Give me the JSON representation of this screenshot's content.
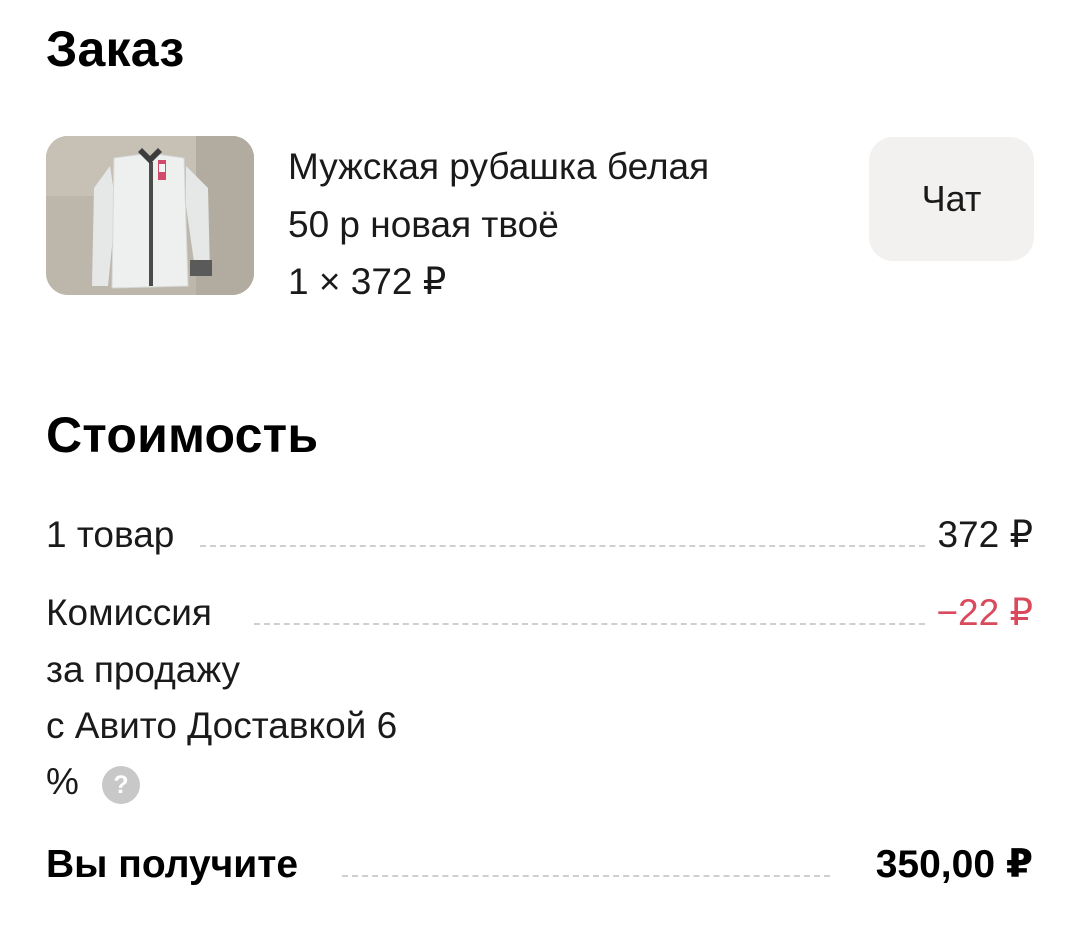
{
  "order": {
    "title": "Заказ",
    "product": {
      "name_line1": "Мужская рубашка белая",
      "name_line2": "50 р новая твоё",
      "qty_price": "1 × 372 ₽"
    },
    "chat_label": "Чат"
  },
  "cost": {
    "title": "Стоимость",
    "items_label": "1 товар",
    "items_value": "372 ₽",
    "commission_lines": [
      "Комиссия",
      "за продажу",
      "с Авито Доставкой 6",
      "%"
    ],
    "commission_value": "−22 ₽",
    "help_icon_glyph": "?",
    "total_label": "Вы получите",
    "total_value": "350,00 ₽"
  },
  "colors": {
    "commission_value": "#d94a5c",
    "chat_button_bg": "#f2f1f0",
    "help_icon_bg": "#c8c8c8"
  },
  "icons": {
    "help": "question-circle-icon"
  }
}
